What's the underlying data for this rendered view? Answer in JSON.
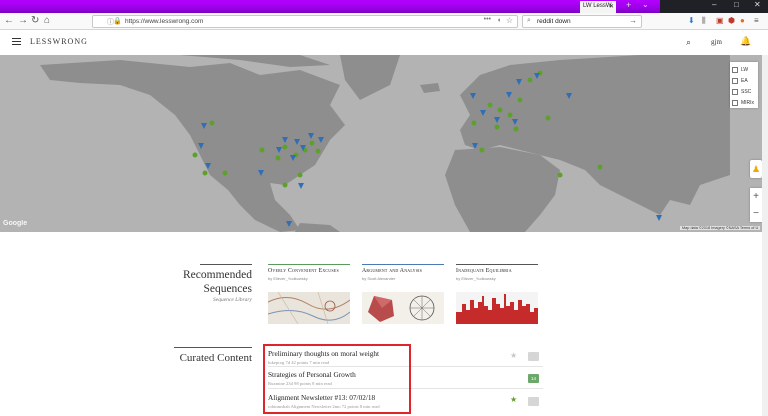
{
  "browser": {
    "active_tab_label": "LW LessW",
    "url": "https://www.lesswrong.com",
    "search_value": "reddit down",
    "colors": {
      "tab_highlight": "#b400ff",
      "chrome_dark": "#1f2126"
    }
  },
  "header": {
    "logo": "LESSWRONG",
    "username": "gjm"
  },
  "map": {
    "filters": [
      {
        "label": "LW",
        "checked": false
      },
      {
        "label": "EA",
        "checked": false
      },
      {
        "label": "SSC",
        "checked": false
      },
      {
        "label": "MIRIx",
        "checked": false
      }
    ],
    "google_label": "Google",
    "attribution": "Map data ©2018 Imagery ©NASA   Terms of U",
    "colors": {
      "land": "#8f8f8f",
      "water": "#b3b3b3",
      "event_dot": "#5ea02c",
      "group_marker": "#2e6fb7"
    }
  },
  "sequences": {
    "title_line1": "Recommended",
    "title_line2": "Sequences",
    "library_link": "Sequence Library",
    "cards": [
      {
        "name": "Overly Convenient Excuses",
        "author": "by Eliezer_Yudkowsky",
        "accent": "#5a9a5a"
      },
      {
        "name": "Argument and Analysis",
        "author": "by Scott Alexander",
        "accent": "#4a7ab0"
      },
      {
        "name": "Inadequate Equilibria",
        "author": "by Eliezer_Yudkowsky",
        "accent": "#555555"
      }
    ]
  },
  "curated": {
    "title": "Curated Content",
    "posts": [
      {
        "title": "Preliminary thoughts on moral weight",
        "meta": "lukeprog   7d   42 points   7 min read",
        "starred": false,
        "comments": "",
        "comment_color": "#d6d6d6"
      },
      {
        "title": "Strategies of Personal Growth",
        "meta": "Ruxmine   23d   98 points   8 min read",
        "starred": false,
        "comments": "14",
        "comment_color": "#6aa96a"
      },
      {
        "title": "Alignment Newsletter #13: 07/02/18",
        "meta": "rohinmshah   Alignment Newsletter   2mo   72 points   8 min read",
        "starred": true,
        "comments": "",
        "comment_color": "#d6d6d6"
      }
    ]
  }
}
